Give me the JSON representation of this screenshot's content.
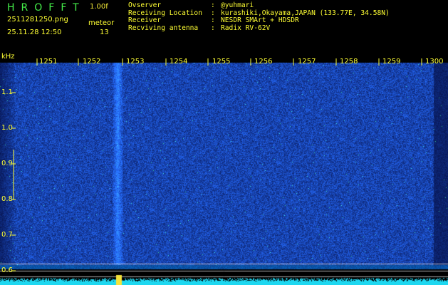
{
  "header": {
    "app_name": "HROFFT",
    "version": "1.00f",
    "file_name": "2511281250.png",
    "mode": "meteor",
    "date": "25.11.28 12:50",
    "count": "13",
    "info": [
      {
        "key": "Ovserver",
        "sep": ":",
        "value": "@yuhmari"
      },
      {
        "key": "Receiving Location",
        "sep": ":",
        "value": "kurashiki,Okayama,JAPAN (133.77E, 34.58N)"
      },
      {
        "key": "Receiver",
        "sep": ":",
        "value": "NESDR SMArt + HDSDR"
      },
      {
        "key": "Recviving antenna",
        "sep": ":",
        "value": "Radix RV-62V"
      }
    ]
  },
  "spectrogram": {
    "y_unit": "kHz",
    "time_axis_labels": [
      "1251",
      "1252",
      "1253",
      "1254",
      "1255",
      "1256",
      "1257",
      "1258",
      "1259",
      "1300"
    ],
    "freq_axis_labels": [
      "1.1",
      "1.0",
      "0.9",
      "0.8",
      "0.7",
      "0.6"
    ],
    "colors": {
      "background": "#000000",
      "label": "#ffff33",
      "noise_low": "#0a1a78",
      "noise_high": "#2f7dd6",
      "baseline": "#22d7f0"
    }
  }
}
